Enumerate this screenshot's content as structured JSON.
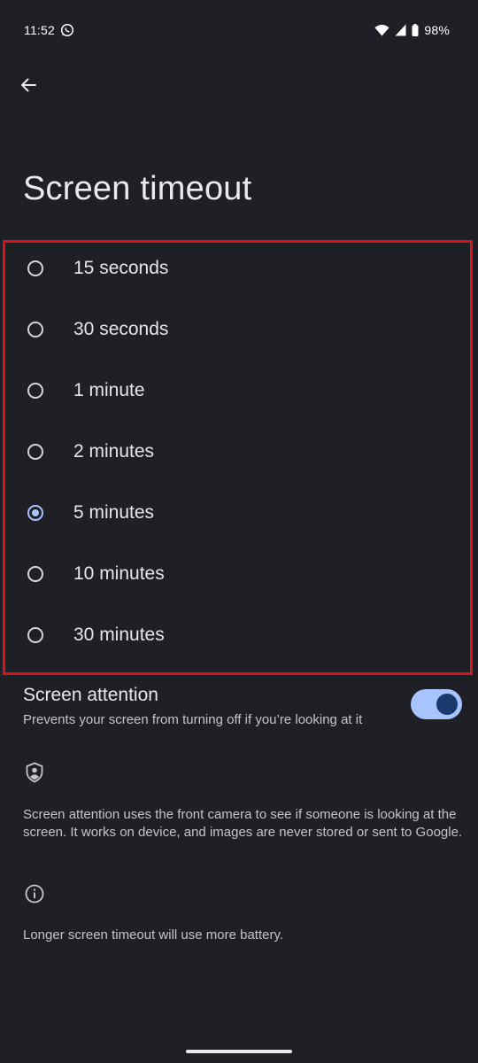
{
  "status_bar": {
    "time": "11:52",
    "battery": "98%",
    "icons": [
      "whatsapp-icon",
      "wifi-icon",
      "cell-signal-icon",
      "battery-icon"
    ]
  },
  "header": {
    "back_icon": "arrow-back-icon",
    "title": "Screen timeout"
  },
  "options": [
    {
      "label": "15 seconds",
      "selected": false
    },
    {
      "label": "30 seconds",
      "selected": false
    },
    {
      "label": "1 minute",
      "selected": false
    },
    {
      "label": "2 minutes",
      "selected": false
    },
    {
      "label": "5 minutes",
      "selected": true
    },
    {
      "label": "10 minutes",
      "selected": false
    },
    {
      "label": "30 minutes",
      "selected": false
    }
  ],
  "screen_attention": {
    "title": "Screen attention",
    "subtitle": "Prevents your screen from turning off if you’re looking at it",
    "enabled": true
  },
  "footer": {
    "privacy_icon": "shield-person-icon",
    "privacy_text": "Screen attention uses the front camera to see if someone is looking at the screen. It works on device, and images are never stored or sent to Google.",
    "info_icon": "info-icon",
    "battery_note": "Longer screen timeout will use more battery."
  },
  "colors": {
    "background": "#1f2025",
    "accent": "#a8c4ff",
    "highlight_border": "#d8131b"
  }
}
